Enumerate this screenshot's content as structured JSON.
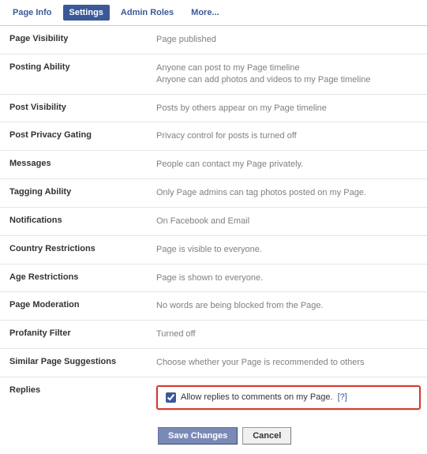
{
  "tabs": {
    "page_info": "Page Info",
    "settings": "Settings",
    "admin_roles": "Admin Roles",
    "more": "More..."
  },
  "rows": {
    "page_visibility": {
      "label": "Page Visibility",
      "value": "Page published"
    },
    "posting_ability": {
      "label": "Posting Ability",
      "line1": "Anyone can post to my Page timeline",
      "line2": "Anyone can add photos and videos to my Page timeline"
    },
    "post_visibility": {
      "label": "Post Visibility",
      "value": "Posts by others appear on my Page timeline"
    },
    "post_privacy_gating": {
      "label": "Post Privacy Gating",
      "value": "Privacy control for posts is turned off"
    },
    "messages": {
      "label": "Messages",
      "value": "People can contact my Page privately."
    },
    "tagging_ability": {
      "label": "Tagging Ability",
      "value": "Only Page admins can tag photos posted on my Page."
    },
    "notifications": {
      "label": "Notifications",
      "value": "On Facebook and Email"
    },
    "country_restrictions": {
      "label": "Country Restrictions",
      "value": "Page is visible to everyone."
    },
    "age_restrictions": {
      "label": "Age Restrictions",
      "value": "Page is shown to everyone."
    },
    "page_moderation": {
      "label": "Page Moderation",
      "value": "No words are being blocked from the Page."
    },
    "profanity_filter": {
      "label": "Profanity Filter",
      "value": "Turned off"
    },
    "similar_page_suggestions": {
      "label": "Similar Page Suggestions",
      "value": "Choose whether your Page is recommended to others"
    },
    "replies": {
      "label": "Replies",
      "checkbox_label": "Allow replies to comments on my Page.",
      "help": "[?]"
    }
  },
  "buttons": {
    "save": "Save Changes",
    "cancel": "Cancel"
  }
}
